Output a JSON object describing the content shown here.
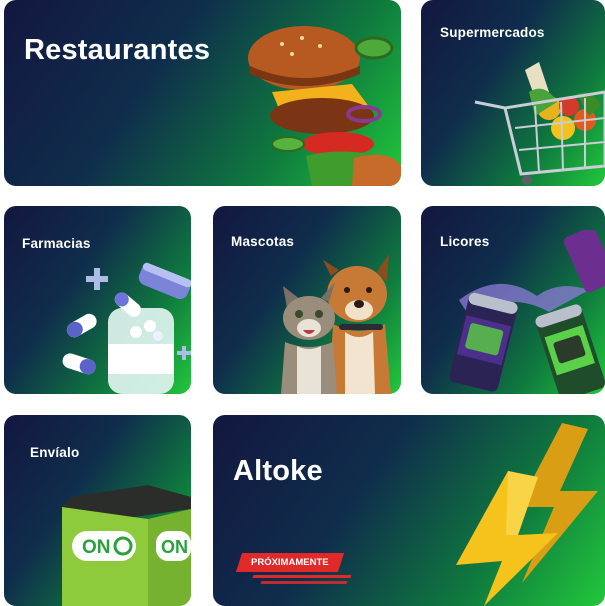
{
  "categories": [
    {
      "id": "restaurantes",
      "label": "Restaurantes"
    },
    {
      "id": "supermercados",
      "label": "Supermercados"
    },
    {
      "id": "farmacias",
      "label": "Farmacias"
    },
    {
      "id": "mascotas",
      "label": "Mascotas"
    },
    {
      "id": "licores",
      "label": "Licores"
    },
    {
      "id": "envialo",
      "label": "Envíalo"
    },
    {
      "id": "altoke",
      "label": "Altoke",
      "badge": "PRÓXIMAMENTE"
    }
  ],
  "bag_brand": "ON",
  "icons": [
    "burger-icon",
    "shopping-cart-icon",
    "pills-icon",
    "cat-dog-icon",
    "cans-icon",
    "delivery-bag-icon",
    "lightning-icon"
  ],
  "colors": {
    "tile_dark": "#13173f",
    "tile_green": "#22c83c",
    "badge_red": "#e02a2a",
    "bolt_yellow": "#f6c21c"
  }
}
